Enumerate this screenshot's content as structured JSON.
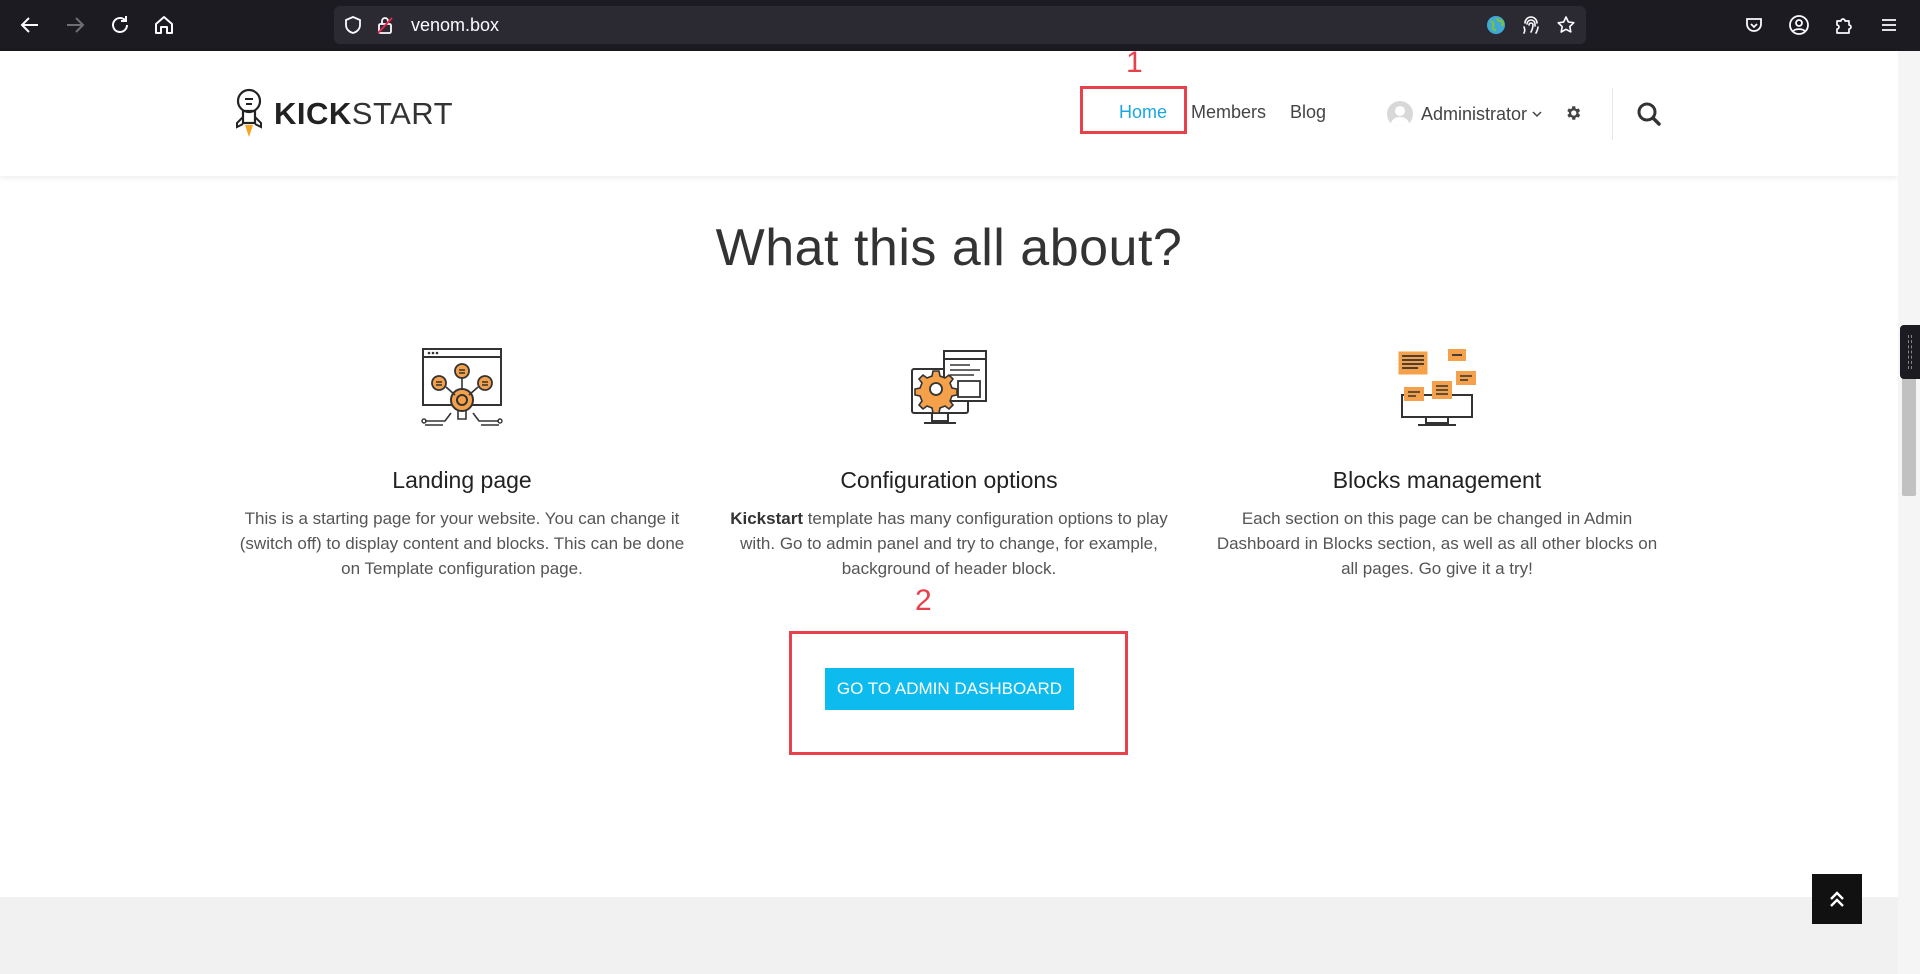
{
  "browser": {
    "url": "venom.box"
  },
  "header": {
    "logo": {
      "bold": "KICK",
      "light": "START"
    },
    "nav": {
      "home": "Home",
      "members": "Members",
      "blog": "Blog"
    },
    "user": {
      "name": "Administrator"
    },
    "accent_color": "#1aa6e0"
  },
  "main": {
    "title": "What this all about?",
    "features": [
      {
        "title": "Landing page",
        "text": "This is a starting page for your website. You can change it (switch off) to display content and blocks. This can be done on Template configuration page."
      },
      {
        "title": "Configuration options",
        "text_bold": "Kickstart",
        "text": " template has many configuration options to play with. Go to admin panel and try to change, for example, background of header block."
      },
      {
        "title": "Blocks management",
        "text": "Each section on this page can be changed in Admin Dashboard in Blocks section, as well as all other blocks on all pages. Go give it a try!"
      }
    ],
    "cta": {
      "label": "GO TO ADMIN DASHBOARD",
      "color": "#0dbbef"
    }
  },
  "annotations": [
    {
      "label": "1",
      "color": "#e8414c"
    },
    {
      "label": "2",
      "color": "#e8414c"
    }
  ]
}
